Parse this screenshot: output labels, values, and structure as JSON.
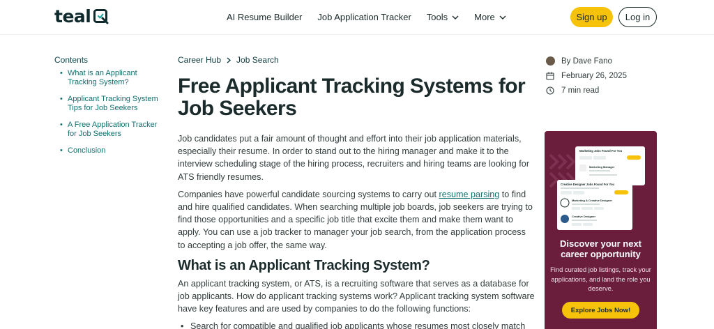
{
  "header": {
    "logo_text": "teal",
    "nav": [
      {
        "label": "AI Resume Builder",
        "has_chevron": false
      },
      {
        "label": "Job Application Tracker",
        "has_chevron": false
      },
      {
        "label": "Tools",
        "has_chevron": true
      },
      {
        "label": "More",
        "has_chevron": true
      }
    ],
    "signup_label": "Sign up",
    "login_label": "Log in"
  },
  "toc": {
    "title": "Contents",
    "items": [
      "What is an Applicant Tracking System?",
      "Applicant Tracking System Tips for Job Seekers",
      "A Free Application Tracker for Job Seekers",
      "Conclusion"
    ]
  },
  "breadcrumb": [
    "Career Hub",
    "Job Search"
  ],
  "article": {
    "title": "Free Applicant Tracking Systems for Job Seekers",
    "para1": "Job candidates put a fair amount of thought and effort into their job application materials, especially their resume. In order to stand out to the hiring manager and make it to the interview scheduling stage of the hiring process, recruiters and hiring teams are looking for ATS friendly resumes.",
    "para2_before": "Companies have powerful candidate sourcing systems to carry out ",
    "para2_link": "resume parsing",
    "para2_after": " to find and hire qualified candidates. When searching multiple job boards, job seekers are trying to find those opportunities and a specific job title that excite them and make them want to apply. You can use a job tracker to manager your job search, from the application process to accepting a job offer, the same way.",
    "h2": "What is an Applicant Tracking System?",
    "para3": "An applicant tracking system, or ATS, is a recruiting software that serves as a database for job applicants. How do applicant tracking systems work? Applicant tracking system software have key features and are used by companies to do the following functions:",
    "bullet1": "Search for compatible and qualified job applicants whose resumes most closely match the job"
  },
  "meta": {
    "author": "By Dave Fano",
    "date": "February 26, 2025",
    "read_time": "7 min read"
  },
  "promo": {
    "card_back_title": "Marketing Jobs Found For You",
    "card_back_job": "Marketing Manager",
    "card_front_title": "Creative Designer Jobs Found For You",
    "card_front_job1": "Marketing & Creative Designer",
    "card_front_job2": "Creative Designer",
    "title": "Discover your next career opportunity",
    "text": "Find curated job listings, track your applications, and land the role you deserve.",
    "button": "Explore Jobs Now!",
    "colors": {
      "background": "#6a1e3c",
      "button": "#f7c20a"
    }
  },
  "colors": {
    "accent": "#12706f",
    "brand_dark": "#0f2a2c",
    "signup": "#f7c20a"
  }
}
